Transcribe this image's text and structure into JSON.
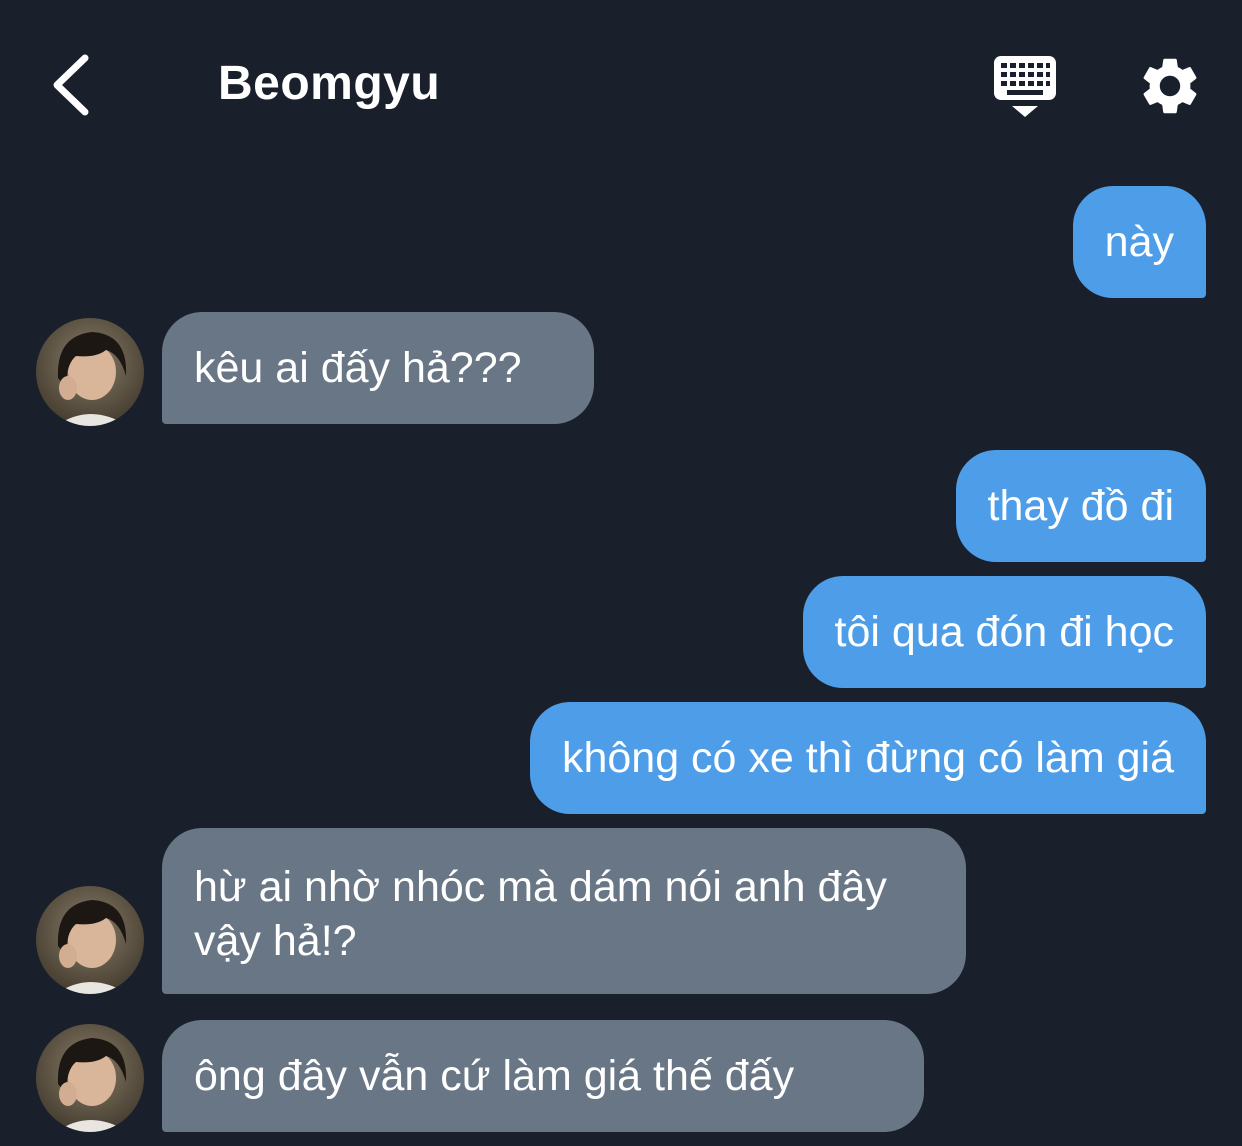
{
  "header": {
    "title": "Beomgyu",
    "back_icon": "chevron-left-icon",
    "keyboard_icon": "keyboard-hide-icon",
    "settings_icon": "gear-icon"
  },
  "colors": {
    "background": "#19202b",
    "outgoing_bubble": "#4d9de8",
    "incoming_bubble": "#687685",
    "text": "#ffffff"
  },
  "messages": [
    {
      "direction": "outgoing",
      "text": "này"
    },
    {
      "direction": "incoming",
      "text": "kêu ai đấy hả???"
    },
    {
      "direction": "outgoing",
      "text": "thay đồ đi"
    },
    {
      "direction": "outgoing",
      "text": "tôi qua đón đi học"
    },
    {
      "direction": "outgoing",
      "text": "không có xe thì đừng có làm giá"
    },
    {
      "direction": "incoming",
      "text": "hừ ai nhờ nhóc mà dám nói anh đây vậy hả!?"
    },
    {
      "direction": "incoming",
      "text": "ông đây vẫn cứ làm giá thế đấy"
    }
  ]
}
